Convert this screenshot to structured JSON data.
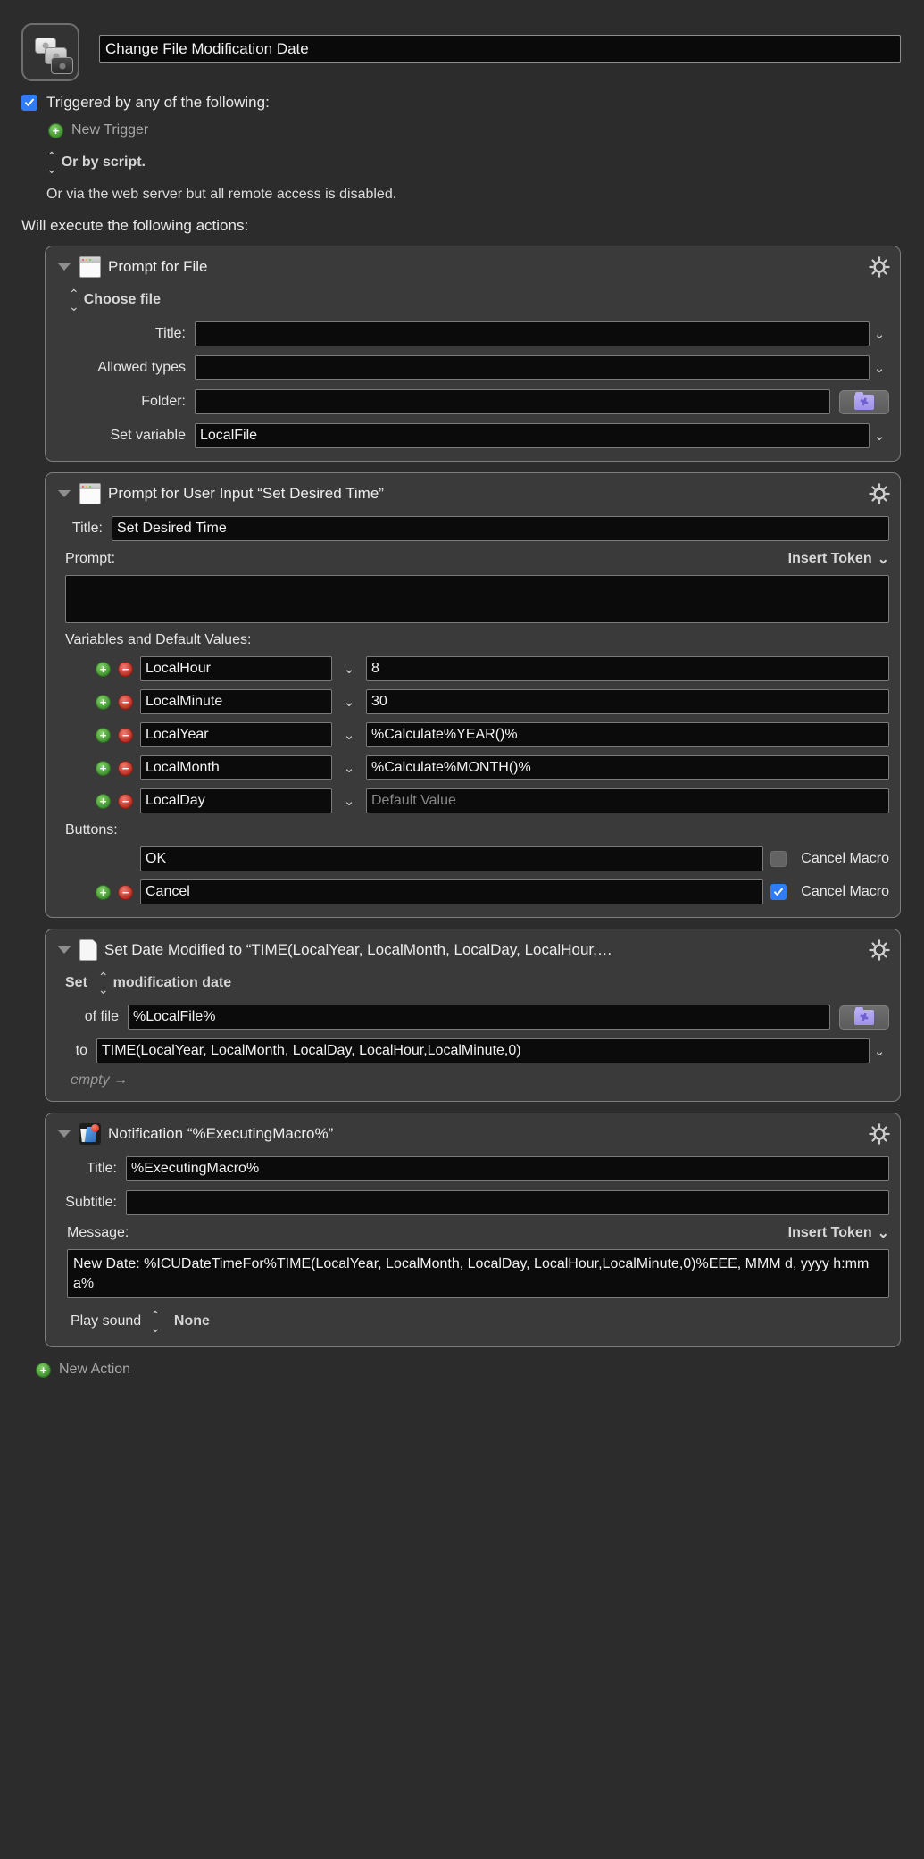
{
  "macro": {
    "icon_name": "macro-group-keys-icon",
    "name_value": "Change File Modification Date"
  },
  "triggers": {
    "checkbox_checked": true,
    "label": "Triggered by any of the following:",
    "new_trigger_label": "New Trigger",
    "or_by_script_label": "Or by script.",
    "web_server_note": "Or via the web server but all remote access is disabled."
  },
  "will_execute_label": "Will execute the following actions:",
  "actions": [
    {
      "title": "Prompt for File",
      "icon": "window-prompt-icon",
      "gear": "gear-icon",
      "mode_label": "Choose file",
      "fields": [
        {
          "label": "Title:",
          "value": "",
          "has_chevron": true
        },
        {
          "label": "Allowed types",
          "value": "",
          "has_chevron": true
        },
        {
          "label": "Folder:",
          "value": "",
          "has_folder_button": true
        },
        {
          "label": "Set variable",
          "value": "LocalFile",
          "has_chevron": true
        }
      ]
    },
    {
      "title": "Prompt for User Input “Set Desired Time”",
      "icon": "window-prompt-icon",
      "gear": "gear-icon",
      "title_field": {
        "label": "Title:",
        "value": "Set Desired Time"
      },
      "prompt_label": "Prompt:",
      "insert_token_label": "Insert Token",
      "prompt_value": "",
      "variables_label": "Variables and Default Values:",
      "variables": [
        {
          "name": "LocalHour",
          "default": "8",
          "placeholder": "Default Value"
        },
        {
          "name": "LocalMinute",
          "default": "30",
          "placeholder": "Default Value"
        },
        {
          "name": "LocalYear",
          "default": "%Calculate%YEAR()%",
          "placeholder": "Default Value"
        },
        {
          "name": "LocalMonth",
          "default": "%Calculate%MONTH()%",
          "placeholder": "Default Value"
        },
        {
          "name": "LocalDay",
          "default": "",
          "placeholder": "Default Value"
        }
      ],
      "buttons_label": "Buttons:",
      "buttons": [
        {
          "label": "OK",
          "cancel_macro_label": "Cancel Macro",
          "cancel_macro_checked": false,
          "has_addremove": false
        },
        {
          "label": "Cancel",
          "cancel_macro_label": "Cancel Macro",
          "cancel_macro_checked": true,
          "has_addremove": true
        }
      ]
    },
    {
      "title": "Set Date Modified to “TIME(LocalYear, LocalMonth, LocalDay, LocalHour,…",
      "icon": "document-icon",
      "gear": "gear-icon",
      "set_label": "Set",
      "set_value": "modification date",
      "of_file_label": "of file",
      "of_file_value": "%LocalFile%",
      "to_label": "to",
      "to_value": "TIME(LocalYear, LocalMonth, LocalDay, LocalHour,LocalMinute,0)",
      "empty_label": "empty →"
    },
    {
      "title": "Notification “%ExecutingMacro%”",
      "icon": "notification-icon",
      "gear": "gear-icon",
      "title_field": {
        "label": "Title:",
        "value": "%ExecutingMacro%"
      },
      "subtitle_field": {
        "label": "Subtitle:",
        "value": ""
      },
      "message_label": "Message:",
      "insert_token_label": "Insert Token",
      "message_value": "New Date: %ICUDateTimeFor%TIME(LocalYear, LocalMonth, LocalDay, LocalHour,LocalMinute,0)%EEE, MMM d, yyyy h:mm a%",
      "play_sound_label": "Play sound",
      "play_sound_value": "None"
    }
  ],
  "new_action_label": "New Action",
  "colors": {
    "background": "#2c2c2c",
    "card": "#3a3a3a",
    "field": "#0b0b0b",
    "accent_blue": "#2f7cf6",
    "add_green": "#3f8f2f",
    "remove_red": "#b62a1e",
    "folder_purple": "#9f92e8"
  }
}
